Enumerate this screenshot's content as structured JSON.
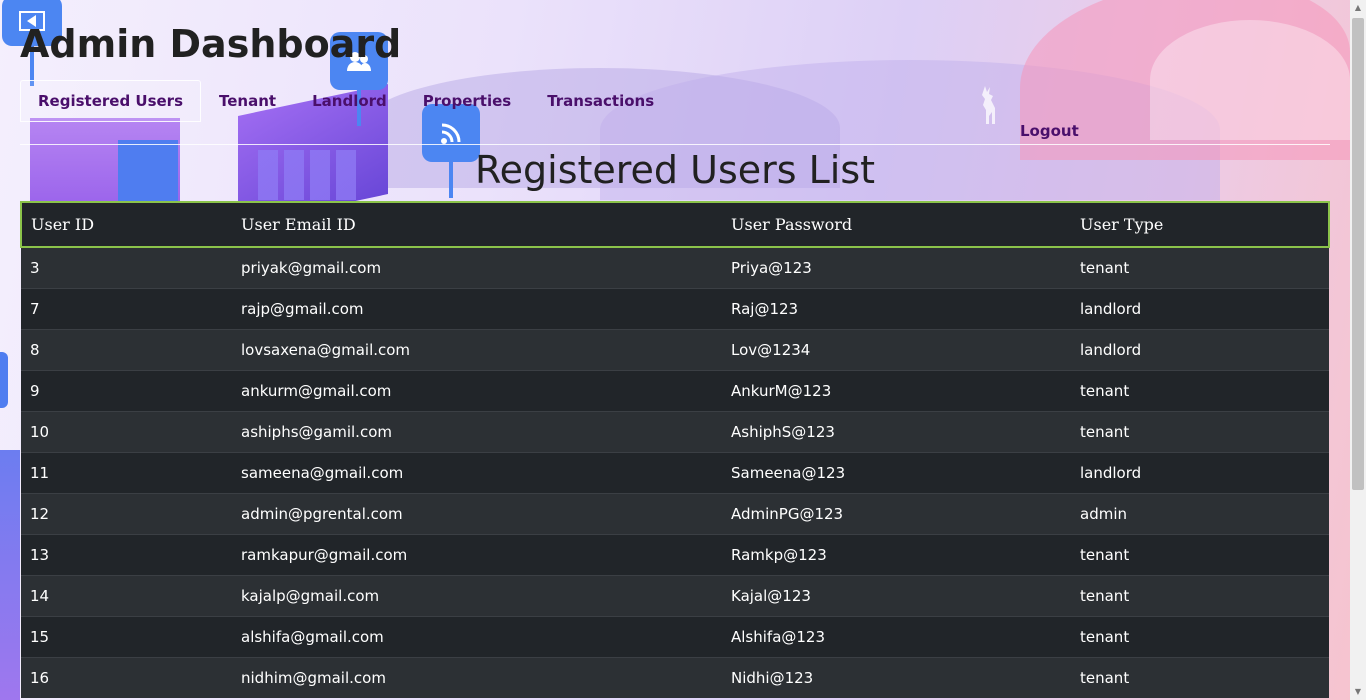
{
  "header": {
    "title": "Admin Dashboard"
  },
  "nav": {
    "items": [
      {
        "label": "Registered Users",
        "active": true
      },
      {
        "label": "Tenant"
      },
      {
        "label": "Landlord"
      },
      {
        "label": "Properties"
      },
      {
        "label": "Transactions"
      }
    ],
    "logout_label": "Logout"
  },
  "main": {
    "heading": "Registered Users List",
    "table": {
      "columns": [
        "User ID",
        "User Email ID",
        "User Password",
        "User Type"
      ],
      "rows": [
        [
          "3",
          "priyak@gmail.com",
          "Priya@123",
          "tenant"
        ],
        [
          "7",
          "rajp@gmail.com",
          "Raj@123",
          "landlord"
        ],
        [
          "8",
          "lovsaxena@gmail.com",
          "Lov@1234",
          "landlord"
        ],
        [
          "9",
          "ankurm@gmail.com",
          "AnkurM@123",
          "tenant"
        ],
        [
          "10",
          "ashiphs@gamil.com",
          "AshiphS@123",
          "tenant"
        ],
        [
          "11",
          "sameena@gmail.com",
          "Sameena@123",
          "landlord"
        ],
        [
          "12",
          "admin@pgrental.com",
          "AdminPG@123",
          "admin"
        ],
        [
          "13",
          "ramkapur@gmail.com",
          "Ramkp@123",
          "tenant"
        ],
        [
          "14",
          "kajalp@gmail.com",
          "Kajal@123",
          "tenant"
        ],
        [
          "15",
          "alshifa@gmail.com",
          "Alshifa@123",
          "tenant"
        ],
        [
          "16",
          "nidhim@gmail.com",
          "Nidhi@123",
          "tenant"
        ]
      ]
    }
  },
  "theme": {
    "nav_text_color": "#4a0f6b",
    "table_bg": "#212529",
    "table_stripe": "#2c3034",
    "header_border": "#8bc34a"
  },
  "icons": [
    "video-icon",
    "users-icon",
    "wifi-icon",
    "deer-icon"
  ]
}
